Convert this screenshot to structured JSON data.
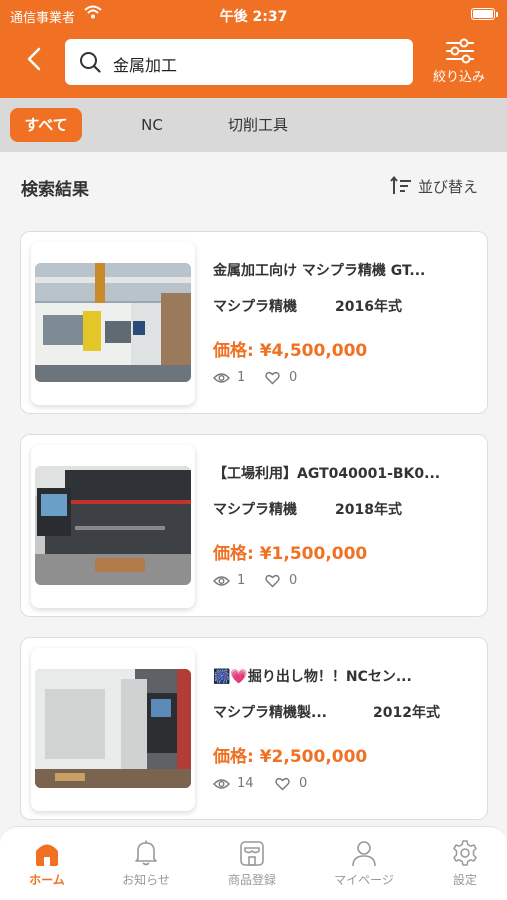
{
  "status_bar": {
    "carrier": "通信事業者",
    "time": "午後 2:37"
  },
  "header": {
    "search_value": "金属加工",
    "filter_label": "絞り込み"
  },
  "tabs": [
    {
      "label": "すべて",
      "active": true
    },
    {
      "label": "NC",
      "active": false
    },
    {
      "label": "切削工具",
      "active": false
    }
  ],
  "results": {
    "title": "検索結果",
    "sort_label": "並び替え"
  },
  "listings": [
    {
      "title": "金属加工向け マシプラ精機 GT...",
      "maker": "マシプラ精機",
      "year": "2016年式",
      "price": "価格: ¥4,500,000",
      "views": "1",
      "likes": "0"
    },
    {
      "title": "【工場利用】AGT040001-BK0...",
      "maker": "マシプラ精機",
      "year": "2018年式",
      "price": "価格: ¥1,500,000",
      "views": "1",
      "likes": "0"
    },
    {
      "title": "🎆💗掘り出し物！！NCセン...",
      "maker": "マシプラ精機製...",
      "year": "2012年式",
      "price": "価格: ¥2,500,000",
      "views": "14",
      "likes": "0"
    }
  ],
  "bottom_nav": [
    {
      "label": "ホーム",
      "icon": "home-icon",
      "active": true
    },
    {
      "label": "お知らせ",
      "icon": "bell-icon",
      "active": false
    },
    {
      "label": "商品登録",
      "icon": "store-icon",
      "active": false
    },
    {
      "label": "マイページ",
      "icon": "user-icon",
      "active": false
    },
    {
      "label": "設定",
      "icon": "gear-icon",
      "active": false
    }
  ],
  "colors": {
    "accent": "#f07123",
    "tab_bar": "#d9d9d9",
    "background": "#f4f4f4"
  }
}
